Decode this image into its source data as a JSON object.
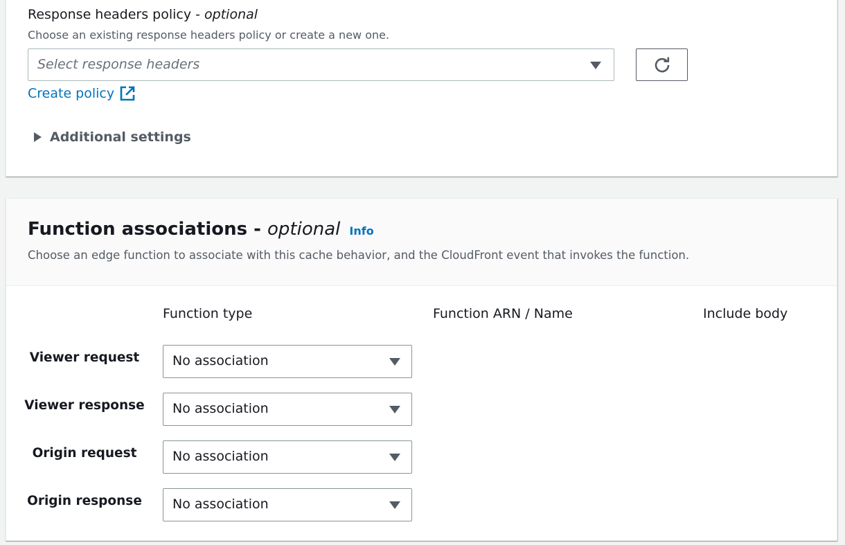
{
  "response_headers": {
    "label": "Response headers policy",
    "label_optional": "optional",
    "description": "Choose an existing response headers policy or create a new one.",
    "select_placeholder": "Select response headers",
    "create_policy_link": "Create policy",
    "additional_settings": "Additional settings"
  },
  "function_associations": {
    "title": "Function associations",
    "title_optional": "optional",
    "info_link": "Info",
    "description": "Choose an edge function to associate with this cache behavior, and the CloudFront event that invokes the function.",
    "columns": [
      "Function type",
      "Function ARN / Name",
      "Include body"
    ],
    "rows": [
      {
        "label": "Viewer request",
        "function_type": "No association"
      },
      {
        "label": "Viewer response",
        "function_type": "No association"
      },
      {
        "label": "Origin request",
        "function_type": "No association"
      },
      {
        "label": "Origin response",
        "function_type": "No association"
      }
    ]
  },
  "colors": {
    "link": "#0073bb",
    "text": "#16191f",
    "muted": "#545b64",
    "background": "#f2f3f3"
  },
  "icons": {
    "caret": "caret-down-icon",
    "refresh": "refresh-icon",
    "external": "external-link-icon",
    "expand": "caret-right-icon"
  }
}
